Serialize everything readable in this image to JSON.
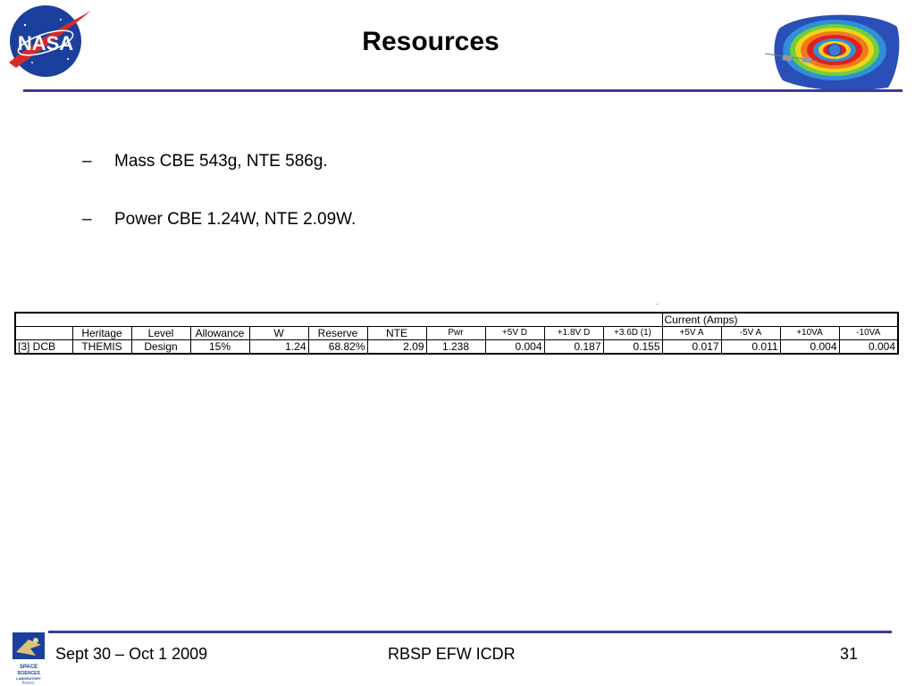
{
  "header": {
    "title": "Resources",
    "logo_left": "NASA"
  },
  "bullets": [
    {
      "dash": "–",
      "text": "Mass CBE 543g, NTE 586g."
    },
    {
      "dash": "–",
      "text": "Power CBE 1.24W, NTE 2.09W."
    }
  ],
  "stray_dot": ".",
  "table": {
    "group_header": "Current (Amps)",
    "columns": [
      "",
      "Heritage",
      "Level",
      "Allowance",
      "W",
      "Reserve",
      "NTE",
      "Pwr",
      "+5V D",
      "+1.8V D",
      "+3.6D (1)",
      "+5V A",
      "-5V A",
      "+10VA",
      "-10VA"
    ],
    "rows": [
      [
        "[3] DCB",
        "THEMIS",
        "Design",
        "15%",
        "1.24",
        "68.82%",
        "2.09",
        "1.238",
        "0.004",
        "0.187",
        "0.155",
        "0.017",
        "0.011",
        "0.004",
        "0.004"
      ]
    ]
  },
  "footer": {
    "date": "Sept 30 – Oct 1 2009",
    "event": "RBSP EFW ICDR",
    "page": "31",
    "lab_logo": "SPACE SCIENCES LABORATORY Berkeley"
  }
}
